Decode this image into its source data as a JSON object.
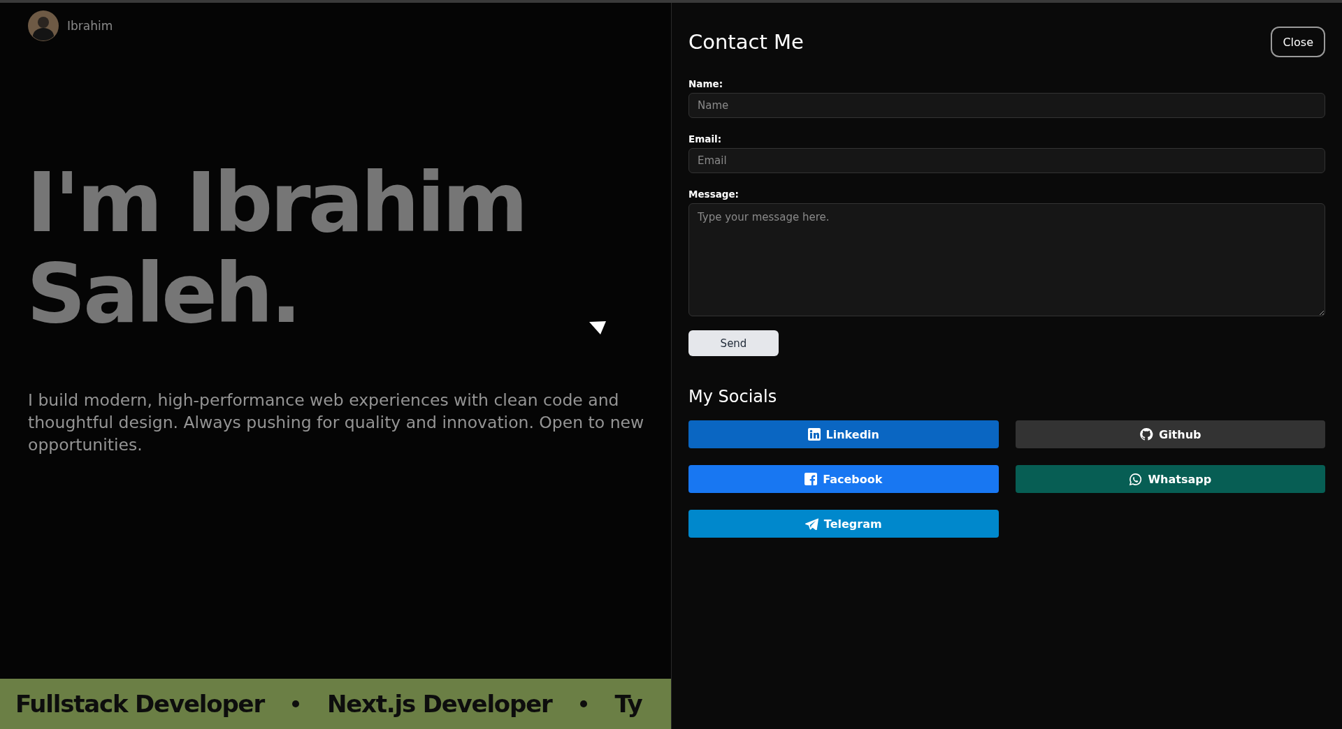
{
  "header": {
    "name": "Ibrahim"
  },
  "hero": {
    "title_lines": [
      "I'm Ibrahim",
      "Saleh."
    ],
    "description": "I build modern, high-performance web experiences with clean code and thoughtful design. Always pushing for quality and innovation. Open to new opportunities."
  },
  "marquee": {
    "items": [
      "Fullstack Developer",
      "Next.js Developer",
      "Ty"
    ]
  },
  "contact": {
    "title": "Contact Me",
    "close": "Close",
    "fields": [
      {
        "kind": "input",
        "label": "Name:",
        "placeholder": "Name"
      },
      {
        "kind": "input",
        "label": "Email:",
        "placeholder": "Email"
      },
      {
        "kind": "textarea",
        "label": "Message:",
        "placeholder": "Type your message here."
      }
    ],
    "send": "Send"
  },
  "socials": {
    "title": "My Socials",
    "buttons": [
      {
        "kind": "linkedin",
        "label": "Linkedin",
        "color": "#0a66c2"
      },
      {
        "kind": "github",
        "label": "Github",
        "color": "#333333"
      },
      {
        "kind": "facebook",
        "label": "Facebook",
        "color": "#1877f2"
      },
      {
        "kind": "whatsapp",
        "label": "Whatsapp",
        "color": "#075e54"
      },
      {
        "kind": "telegram",
        "label": "Telegram",
        "color": "#0088cc"
      }
    ]
  }
}
